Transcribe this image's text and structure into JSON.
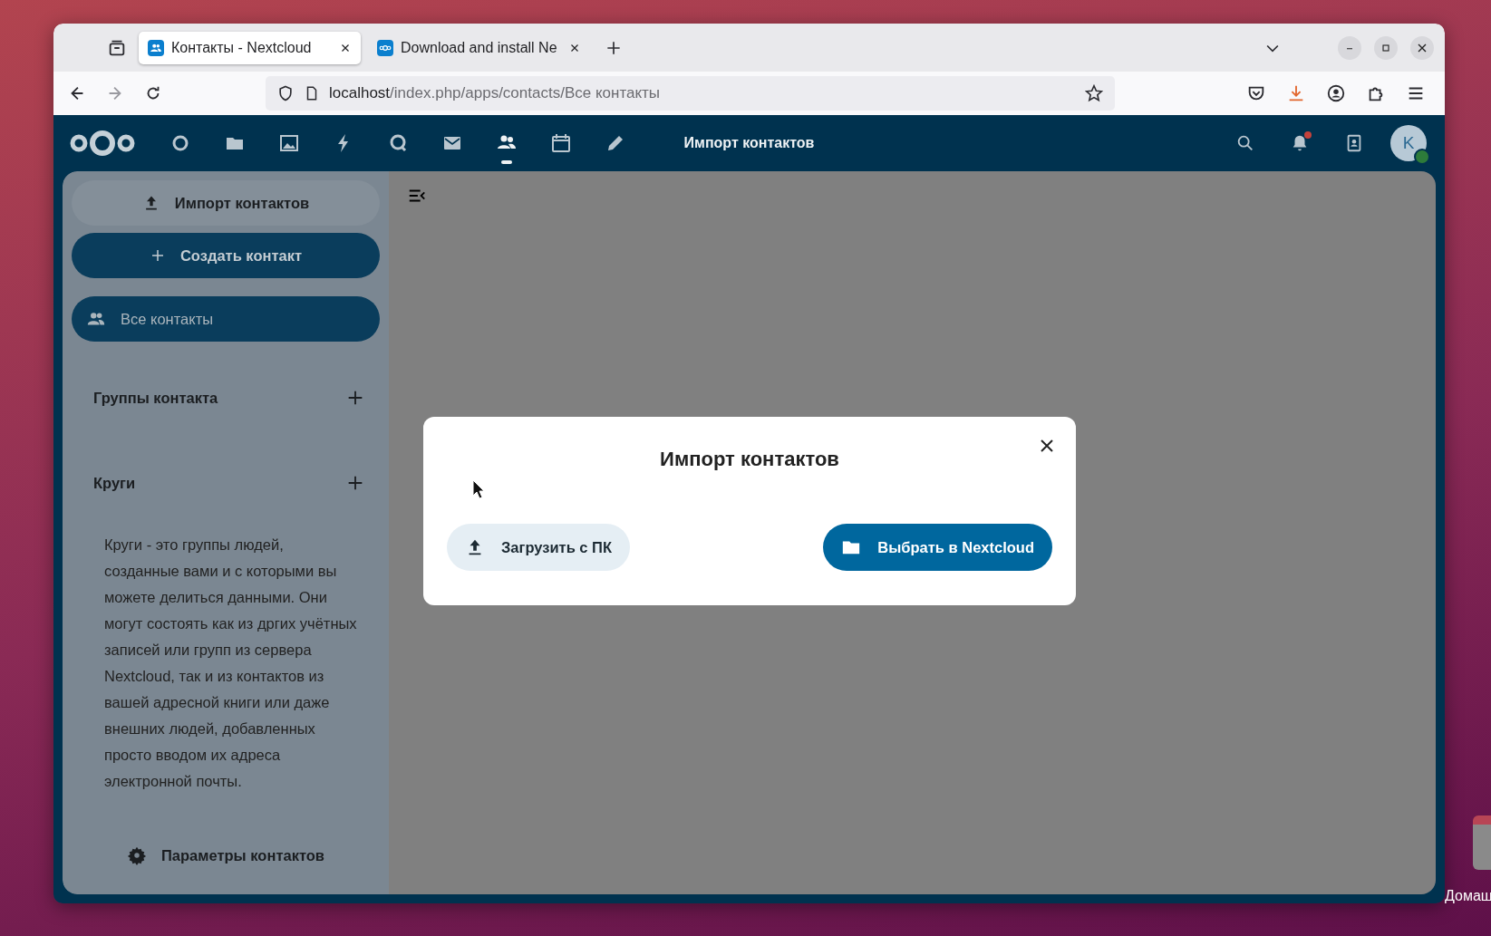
{
  "browser": {
    "tabs": [
      {
        "title": "Контакты - Nextcloud",
        "selected": true,
        "kind": "contacts"
      },
      {
        "title": "Download and install Ne",
        "selected": false,
        "kind": "nextcloud"
      }
    ],
    "url": {
      "host": "localhost",
      "path": "/index.php/apps/contacts/Все контакты"
    },
    "download_active": true
  },
  "header": {
    "apps": [
      {
        "kind": "dashboard",
        "selected": false
      },
      {
        "kind": "files",
        "selected": false
      },
      {
        "kind": "photos",
        "selected": false
      },
      {
        "kind": "activity",
        "selected": false
      },
      {
        "kind": "talk",
        "selected": false
      },
      {
        "kind": "mail",
        "selected": false
      },
      {
        "kind": "contacts",
        "selected": true
      },
      {
        "kind": "calendar",
        "selected": false
      },
      {
        "kind": "notes",
        "selected": false
      }
    ],
    "title": "Импорт контактов",
    "notifications_unread": true,
    "avatar_letter": "K",
    "status_online": true
  },
  "sidebar": {
    "import_button": "Импорт контактов",
    "create_button": "Создать контакт",
    "all_contacts": {
      "label": "Все контакты",
      "selected": true
    },
    "sections": [
      {
        "title": "Группы контакта"
      },
      {
        "title": "Круги"
      }
    ],
    "circles_description": "Круги - это группы людей, созданные вами и с которыми вы можете делиться данными. Они могут состоять как из дргих учётных записей или групп из сервера Nextcloud, так и из контактов из вашей адресной книги или даже внешних людей, добавленных просто вводом их адреса электронной почты.",
    "settings_button": "Параметры контактов"
  },
  "modal": {
    "title": "Импорт контактов",
    "buttons": [
      {
        "label": "Загрузить с ПК",
        "kind": "secondary"
      },
      {
        "label": "Выбрать в Nextcloud",
        "kind": "primary"
      }
    ]
  },
  "desktop": {
    "icon_label": "Домаш"
  }
}
